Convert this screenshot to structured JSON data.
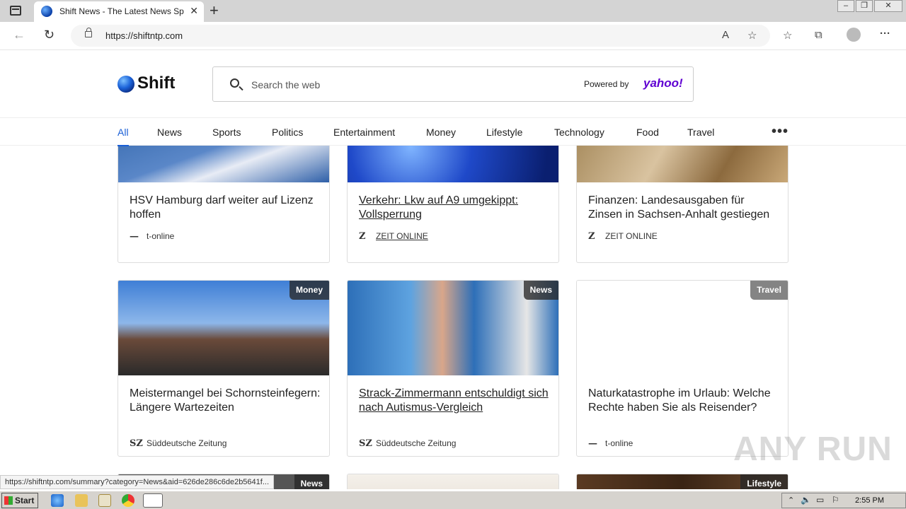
{
  "browser": {
    "tab_title": "Shift News - The Latest News Sports",
    "url": "https://shiftntp.com",
    "status_url": "https://shiftntp.com/summary?category=News&aid=626de286c6de2b5641f..."
  },
  "site": {
    "logo_text": "Shift",
    "search_placeholder": "Search the web",
    "powered_by": "Powered by",
    "yahoo": "yahoo!"
  },
  "nav": {
    "categories": [
      "All",
      "News",
      "Sports",
      "Politics",
      "Entertainment",
      "Money",
      "Lifestyle",
      "Technology",
      "Food",
      "Travel"
    ],
    "more": "•••"
  },
  "cards": [
    {
      "title": "HSV Hamburg darf weiter auf Lizenz hoffen",
      "source": "t-online",
      "source_logo": "—",
      "link": false,
      "badge": ""
    },
    {
      "title": "Verkehr: Lkw auf A9 umgekippt: Vollsperrung",
      "source": "ZEIT ONLINE",
      "source_logo": "Z",
      "link": true,
      "badge": ""
    },
    {
      "title": "Finanzen: Landesausgaben für Zinsen in Sachsen-Anhalt gestiegen",
      "source": "ZEIT ONLINE",
      "source_logo": "Z",
      "link": false,
      "badge": ""
    },
    {
      "title": "Meistermangel bei Schornsteinfegern: Längere Wartezeiten",
      "source": "Süddeutsche Zeitung",
      "source_logo": "SZ",
      "link": false,
      "badge": "Money"
    },
    {
      "title": "Strack-Zimmermann entschuldigt sich nach Autismus-Vergleich",
      "source": "Süddeutsche Zeitung",
      "source_logo": "SZ",
      "link": true,
      "badge": "News"
    },
    {
      "title": "Naturkatastrophe im Urlaub: Welche Rechte haben Sie als Reisender?",
      "source": "t-online",
      "source_logo": "—",
      "link": false,
      "badge": "Travel"
    },
    {
      "badge": "News"
    },
    {
      "badge": ""
    },
    {
      "badge": "Lifestyle"
    }
  ],
  "taskbar": {
    "start": "Start",
    "clock": "2:55 PM"
  },
  "watermark": "ANY RUN"
}
